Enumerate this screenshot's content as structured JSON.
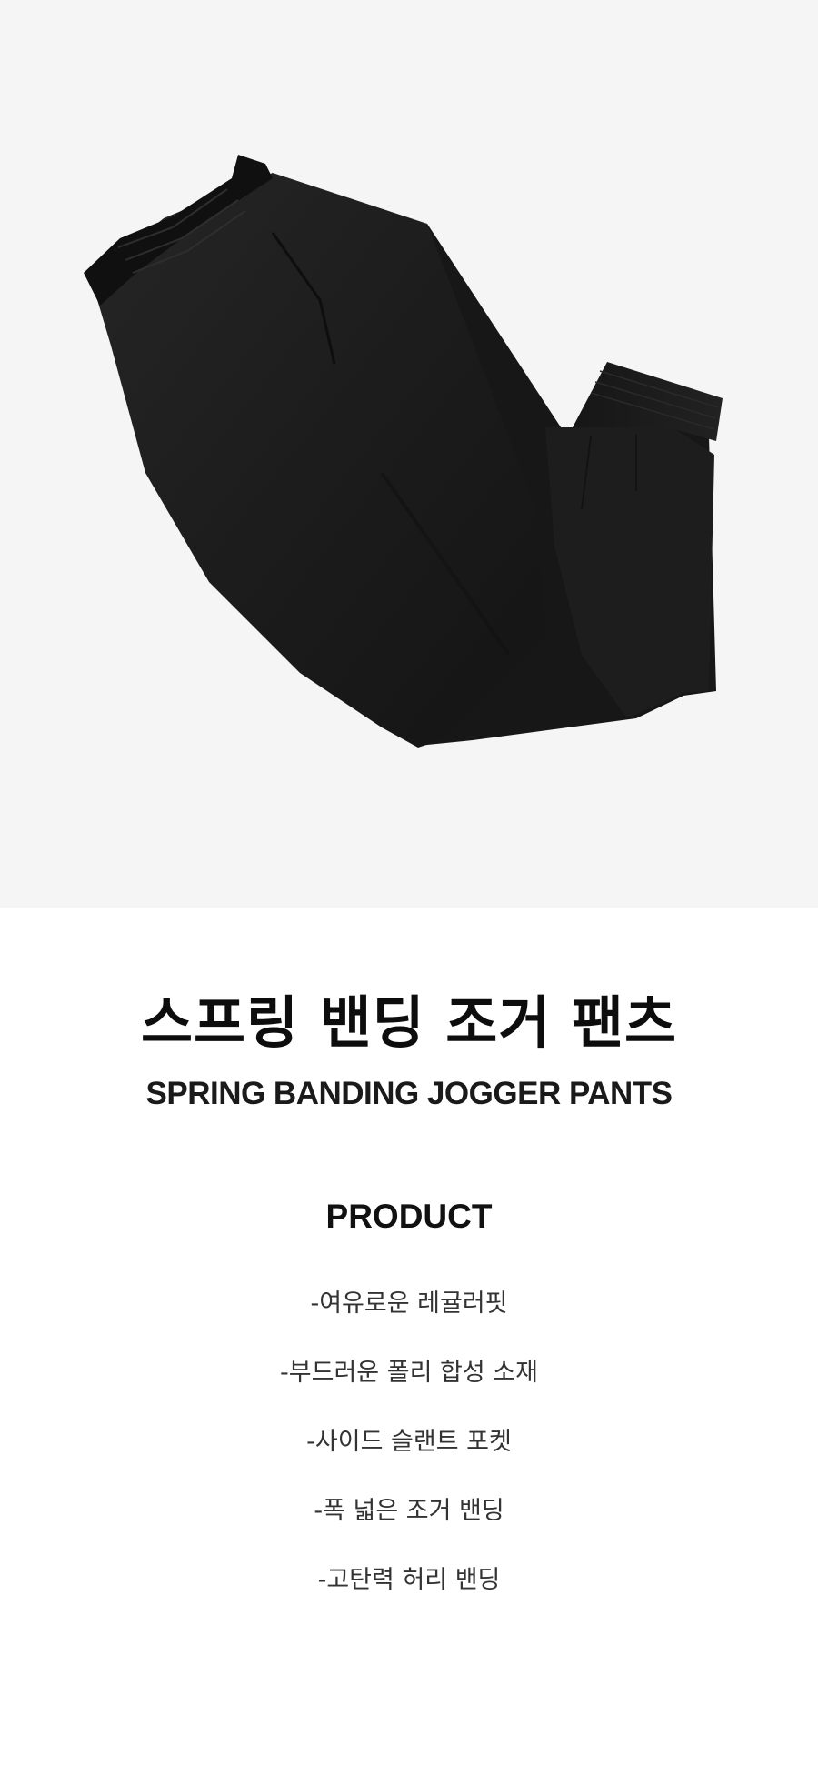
{
  "product": {
    "image": {
      "icon": "jogger-pants-photo",
      "background_color": "#f5f5f5",
      "garment_color": "#1b1b1b"
    },
    "title_ko": "스프링 밴딩 조거 팬츠",
    "title_en": "SPRING BANDING JOGGER PANTS",
    "section_heading": "PRODUCT",
    "features": [
      "-여유로운 레귤러핏",
      "-부드러운 폴리 합성 소재",
      "-사이드 슬랜트 포켓",
      "-폭 넓은 조거 밴딩",
      "-고탄력 허리 밴딩"
    ]
  }
}
